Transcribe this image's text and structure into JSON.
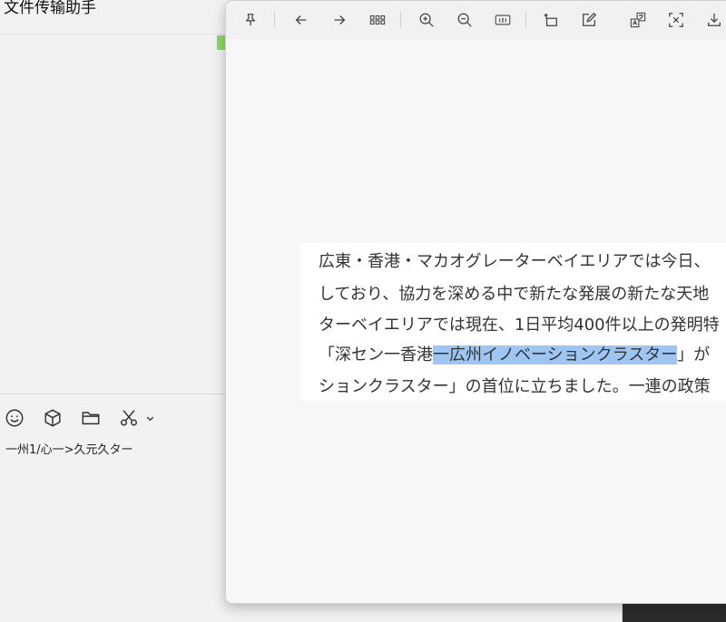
{
  "chat": {
    "title": "文件传输助手",
    "draft_text": "一州1/心一>久元久ター",
    "toolbar_icons": [
      "emoji-icon",
      "cube-icon",
      "folder-icon",
      "scissors-icon",
      "chevron-down-icon"
    ]
  },
  "viewer": {
    "toolbar_icons": [
      "pin-icon",
      "arrow-left-icon",
      "arrow-right-icon",
      "grid-icon",
      "zoom-in-icon",
      "zoom-out-icon",
      "actual-size-icon",
      "rotate-icon",
      "edit-icon",
      "translate-icon",
      "ocr-scan-icon",
      "download-icon"
    ],
    "document": {
      "lines": [
        {
          "text": "広東・香港・マカオグレーターベイエリアでは今日、"
        },
        {
          "text": "しており、協力を深める中で新たな発展の新たな天地"
        },
        {
          "text": "ターベイエリアでは現在、1日平均400件以上の発明特"
        },
        {
          "before": "「深セン一香港",
          "highlight": "一広州イノベーションクラスター",
          "after": "」が"
        },
        {
          "text": "ションクラスター」の首位に立ちました。一連の政策"
        }
      ]
    }
  },
  "colors": {
    "highlight": "#9ec6f3",
    "accent_green": "#89d961"
  }
}
